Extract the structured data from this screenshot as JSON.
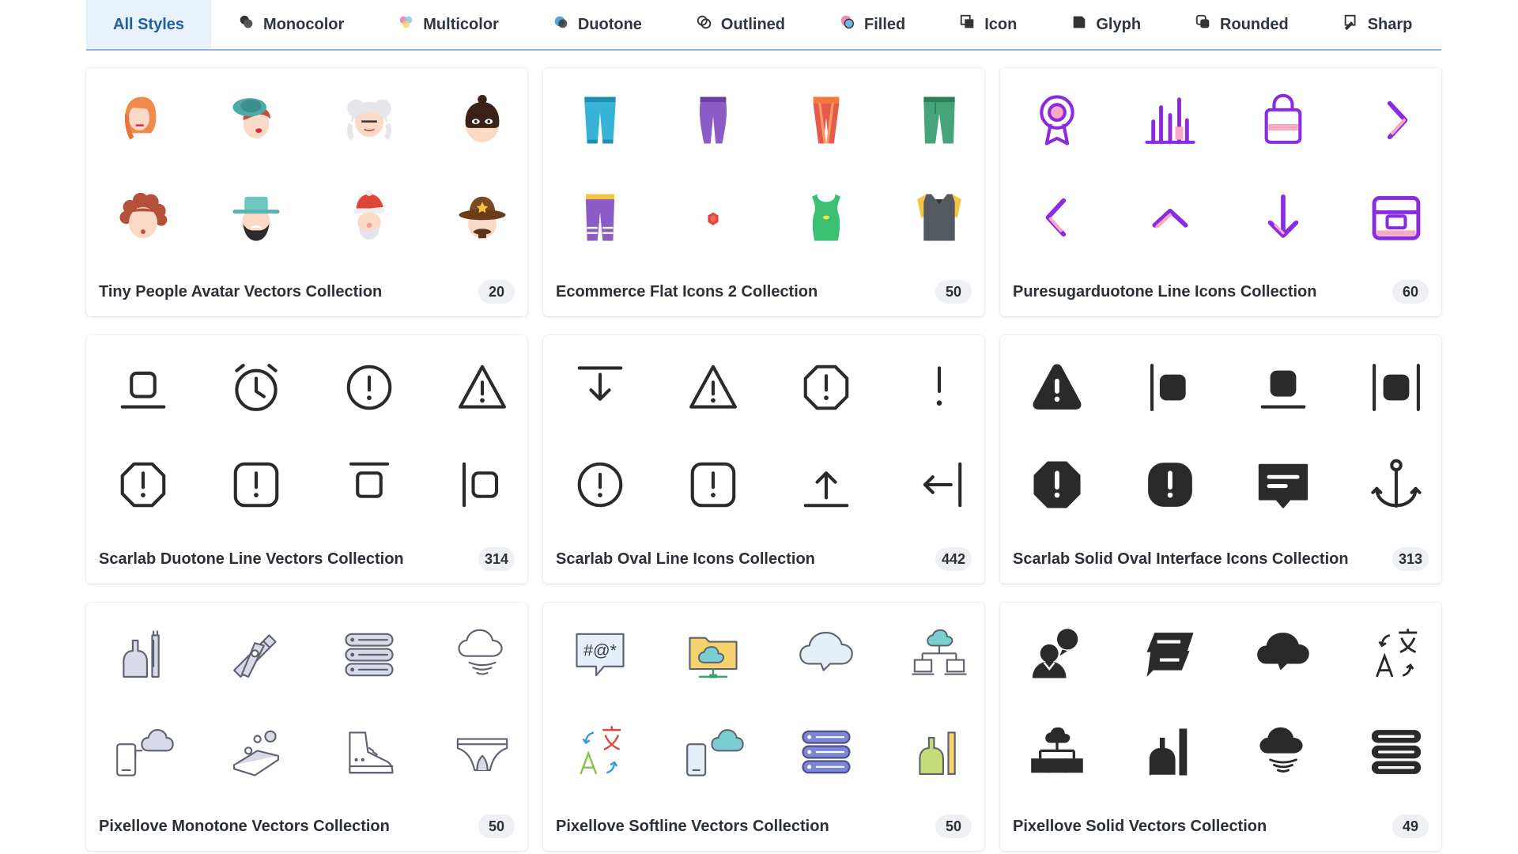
{
  "tabs": [
    {
      "label": "All Styles",
      "icon": "all-styles-icon",
      "active": true
    },
    {
      "label": "Monocolor",
      "icon": "monocolor-icon"
    },
    {
      "label": "Multicolor",
      "icon": "multicolor-icon"
    },
    {
      "label": "Duotone",
      "icon": "duotone-icon"
    },
    {
      "label": "Outlined",
      "icon": "outlined-icon"
    },
    {
      "label": "Filled",
      "icon": "filled-icon"
    },
    {
      "label": "Icon",
      "icon": "icon-style-icon"
    },
    {
      "label": "Glyph",
      "icon": "glyph-icon"
    },
    {
      "label": "Rounded",
      "icon": "rounded-icon"
    },
    {
      "label": "Sharp",
      "icon": "sharp-icon"
    }
  ],
  "colors": {
    "accent": "#1f5fa8",
    "active_tab_bg": "#e9f1fb",
    "tab_underline": "#93b4dc",
    "badge_bg": "#eef0f3",
    "purple": "#8a2be2",
    "pink": "#f7a8c4"
  },
  "collections": [
    {
      "title": "Tiny People Avatar Vectors Collection",
      "count": "20",
      "icons": [
        "woman-redhead-icon",
        "woman-hat-icon",
        "grandma-icon",
        "robber-mask-icon",
        "curly-hair-icon",
        "cowboy-beard-icon",
        "santa-claus-icon",
        "sheriff-icon"
      ]
    },
    {
      "title": "Ecommerce Flat Icons 2 Collection",
      "count": "50",
      "icons": [
        "blue-pants-icon",
        "purple-pants-icon",
        "leggings-icon",
        "green-pants-icon",
        "striped-pants-icon",
        "small-gem-icon",
        "green-top-icon",
        "sweater-vest-icon"
      ]
    },
    {
      "title": "Puresugarduotone Line Icons Collection",
      "count": "60",
      "icons": [
        "award-ribbon-icon",
        "bar-chart-icon",
        "shopping-bag-icon",
        "chevron-right-icon",
        "chevron-left-icon",
        "chevron-up-icon",
        "arrow-down-icon",
        "archive-box-icon"
      ]
    },
    {
      "title": "Scarlab Duotone Line Vectors Collection",
      "count": "314",
      "icons": [
        "align-bottom-icon",
        "alarm-clock-icon",
        "alert-circle-icon",
        "alert-triangle-icon",
        "alert-octagon-icon",
        "alert-square-icon",
        "align-top-icon",
        "align-left-icon"
      ]
    },
    {
      "title": "Scarlab Oval Line Icons Collection",
      "count": "442",
      "icons": [
        "arrow-down-to-line-icon",
        "alert-triangle-icon",
        "alert-octagon-icon",
        "exclamation-icon",
        "alert-circle-icon",
        "alert-square-icon",
        "arrow-up-from-line-icon",
        "arrow-left-to-line-icon"
      ]
    },
    {
      "title": "Scarlab Solid Oval Interface Icons Collection",
      "count": "313",
      "icons": [
        "alert-triangle-solid-icon",
        "align-left-solid-icon",
        "align-bottom-solid-icon",
        "align-center-solid-icon",
        "alert-octagon-solid-icon",
        "alert-square-solid-icon",
        "message-solid-icon",
        "anchor-icon"
      ]
    },
    {
      "title": "Pixellove Monotone Vectors Collection",
      "count": "50",
      "icons": [
        "dustpan-brush-icon",
        "clothes-peg-icon",
        "server-stack-icon",
        "cloud-signal-icon",
        "phone-cloud-icon",
        "soap-bubbles-icon",
        "sneaker-icon",
        "underwear-icon"
      ]
    },
    {
      "title": "Pixellove Softline Vectors Collection",
      "count": "50",
      "icons": [
        "speech-symbols-icon",
        "cloud-folder-icon",
        "thought-cloud-icon",
        "cloud-network-icon",
        "translate-icon",
        "phone-cloud-icon",
        "server-stack-icon",
        "dustpan-brush-icon"
      ]
    },
    {
      "title": "Pixellove Solid Vectors Collection",
      "count": "49",
      "icons": [
        "chat-user-icon",
        "chat-bubbles-icon",
        "thought-cloud-icon",
        "translate-icon",
        "cloud-network-icon",
        "dustpan-brush-icon",
        "cloud-signal-icon",
        "server-stack-icon"
      ]
    }
  ]
}
